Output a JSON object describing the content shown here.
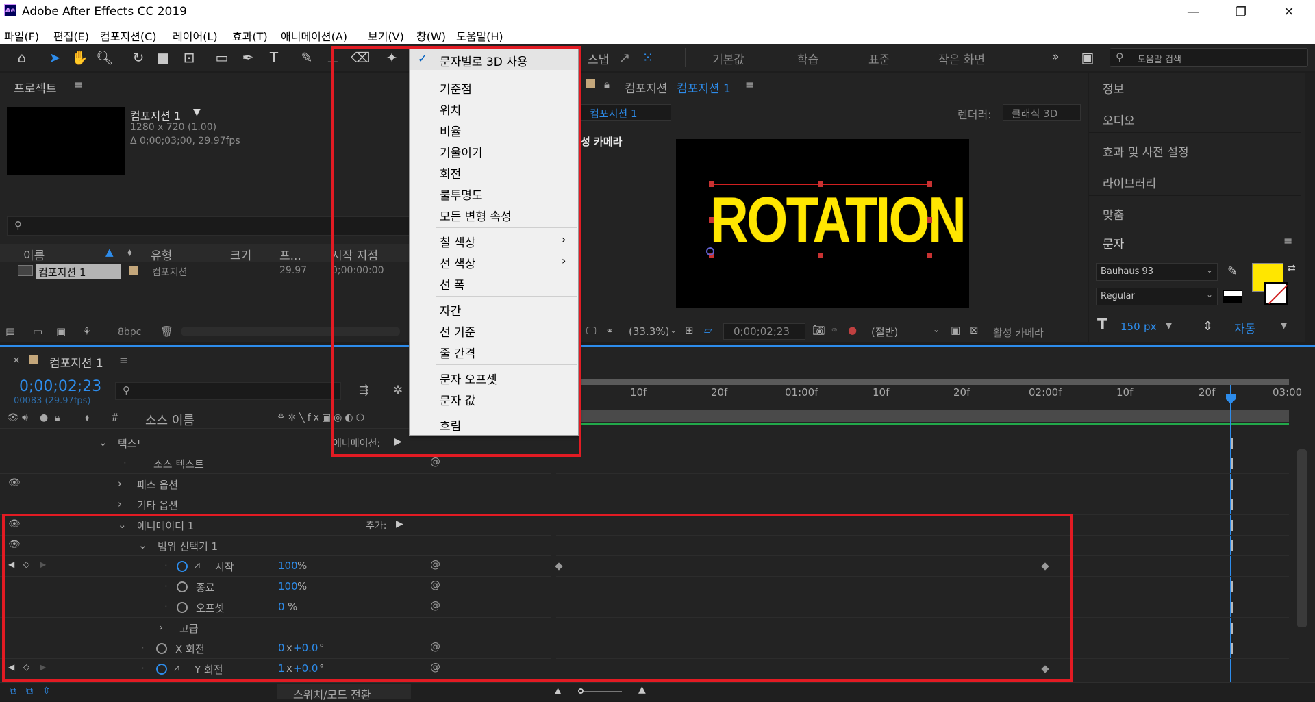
{
  "window": {
    "logo": "Ae",
    "title": "Adobe After Effects CC 2019",
    "minimize": "—",
    "restore": "❐",
    "close": "✕"
  },
  "menu": [
    "파일(F)",
    "편집(E)",
    "컴포지션(C)",
    "레이어(L)",
    "효과(T)",
    "애니메이션(A)",
    "보기(V)",
    "창(W)",
    "도움말(H)"
  ],
  "toolbar": {
    "snap_label": "스냅",
    "workspaces": [
      "기본값",
      "학습",
      "표준",
      "작은 화면"
    ],
    "more": "»",
    "help_search_placeholder": "도움말 검색"
  },
  "project": {
    "tab_label": "프로젝트",
    "comp_name": "컴포지션 1",
    "comp_size": "1280 x 720 (1.00)",
    "comp_duration": "Δ 0;00;03;00, 29.97fps",
    "columns": [
      "이름",
      "유형",
      "크기",
      "프...",
      "시작 지점"
    ],
    "item": {
      "name": "컴포지션 1",
      "type": "컴포지션",
      "fps": "29.97",
      "start": "0;00:00:00"
    },
    "bpc": "8bpc"
  },
  "viewer": {
    "tab_prefix": "컴포지션",
    "tab_name": "컴포지션 1",
    "comp_tab": "컴포지션 1",
    "renderer_label": "렌더러:",
    "renderer_value": "클래식 3D",
    "camera_label": "성 카메라",
    "text_content": "ROTATION",
    "zoom": "(33.3%)",
    "timecode": "0;00;02;23",
    "resolution": "(절반)",
    "active_camera": "활성 카메라"
  },
  "right_panels": {
    "items": [
      "정보",
      "오디오",
      "효과 및 사전 설정",
      "라이브러리",
      "맞춤"
    ],
    "char_title": "문자",
    "font": "Bauhaus 93",
    "style": "Regular",
    "size": "150",
    "size_unit": "px",
    "leading": "자동",
    "fill_color": "#ffe600"
  },
  "timeline": {
    "tab": "컴포지션 1",
    "timecode": "0;00;02;23",
    "frame_info": "00083 (29.97fps)",
    "source_name_header": "소스 이름",
    "ruler": [
      "10f",
      "20f",
      "01:00f",
      "10f",
      "20f",
      "02:00f",
      "10f",
      "20f",
      "03:00"
    ],
    "rows": [
      {
        "label": "텍스트"
      },
      {
        "label": "소스 텍스트"
      },
      {
        "label": "패스 옵션"
      },
      {
        "label": "기타 옵션"
      },
      {
        "label": "애니메이터 1",
        "extra": "추가:"
      },
      {
        "label": "범위 선택기 1"
      },
      {
        "label": "시작",
        "value": "100",
        "unit": "%"
      },
      {
        "label": "종료",
        "value": "100",
        "unit": "%"
      },
      {
        "label": "오프셋",
        "value": "0",
        "unit": "%"
      },
      {
        "label": "고급"
      },
      {
        "label": "X 회전",
        "value_a": "0",
        "value_x": "x",
        "value_b": "+0.0",
        "unit": "°"
      },
      {
        "label": "Y 회전",
        "value_a": "1",
        "value_x": "x",
        "value_b": "+0.0",
        "unit": "°"
      }
    ],
    "animate_label": "애니메이션:",
    "bottom_switch": "스위치/모드 전환"
  },
  "context_menu": {
    "checked": "문자별로 3D 사용",
    "group1": [
      "기준점",
      "위치",
      "비율",
      "기울이기",
      "회전",
      "불투명도",
      "모든 변형 속성"
    ],
    "group2": [
      "칠 색상",
      "선 색상",
      "선 폭"
    ],
    "group3": [
      "자간",
      "선 기준",
      "줄 간격"
    ],
    "group4": [
      "문자 오프셋",
      "문자 값"
    ],
    "group5": [
      "흐림"
    ]
  }
}
